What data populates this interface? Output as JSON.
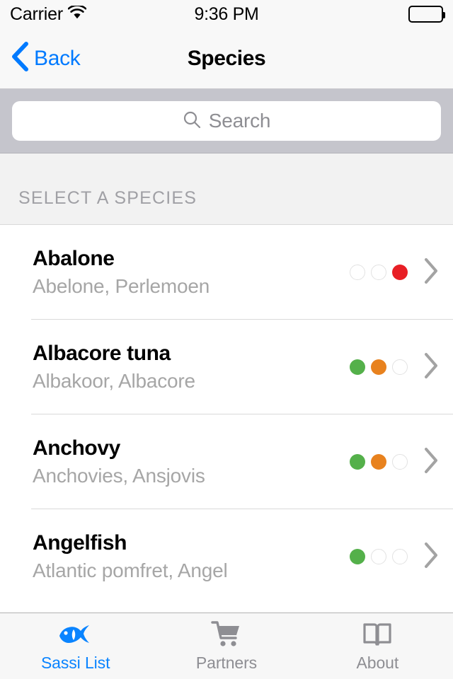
{
  "status_bar": {
    "carrier": "Carrier",
    "wifi_icon": "wifi-icon",
    "time": "9:36 PM",
    "battery_icon": "battery-full-icon"
  },
  "nav_bar": {
    "back_label": "Back",
    "back_icon": "chevron-left-icon",
    "title": "Species"
  },
  "search": {
    "placeholder": "Search",
    "value": "",
    "icon": "search-icon"
  },
  "section": {
    "header": "SELECT A SPECIES"
  },
  "colors": {
    "accent_blue": "#007AFF",
    "tab_active_blue": "#0A84FF",
    "green": "#54B04A",
    "orange": "#E8821E",
    "red": "#E81F25",
    "dot_empty_border": "#E2E2E2",
    "search_bar_background": "#C5C5CC",
    "section_background": "#F2F2F2",
    "separator": "#D9D9D9",
    "secondary_text": "#A6A6A6"
  },
  "species": [
    {
      "name": "Abalone",
      "alt_names": "Abelone, Perlemoen",
      "ratings": {
        "green": false,
        "orange": false,
        "red": true
      },
      "chevron_icon": "chevron-right-icon"
    },
    {
      "name": "Albacore tuna",
      "alt_names": "Albakoor, Albacore",
      "ratings": {
        "green": true,
        "orange": true,
        "red": false
      },
      "chevron_icon": "chevron-right-icon"
    },
    {
      "name": "Anchovy",
      "alt_names": "Anchovies, Ansjovis",
      "ratings": {
        "green": true,
        "orange": true,
        "red": false
      },
      "chevron_icon": "chevron-right-icon"
    },
    {
      "name": "Angelfish",
      "alt_names": "Atlantic pomfret, Angel",
      "ratings": {
        "green": true,
        "orange": false,
        "red": false
      },
      "chevron_icon": "chevron-right-icon"
    }
  ],
  "tab_bar": {
    "items": [
      {
        "label": "Sassi List",
        "icon": "fish-icon",
        "active": true
      },
      {
        "label": "Partners",
        "icon": "shopping-cart-icon",
        "active": false
      },
      {
        "label": "About",
        "icon": "open-book-icon",
        "active": false
      }
    ]
  }
}
